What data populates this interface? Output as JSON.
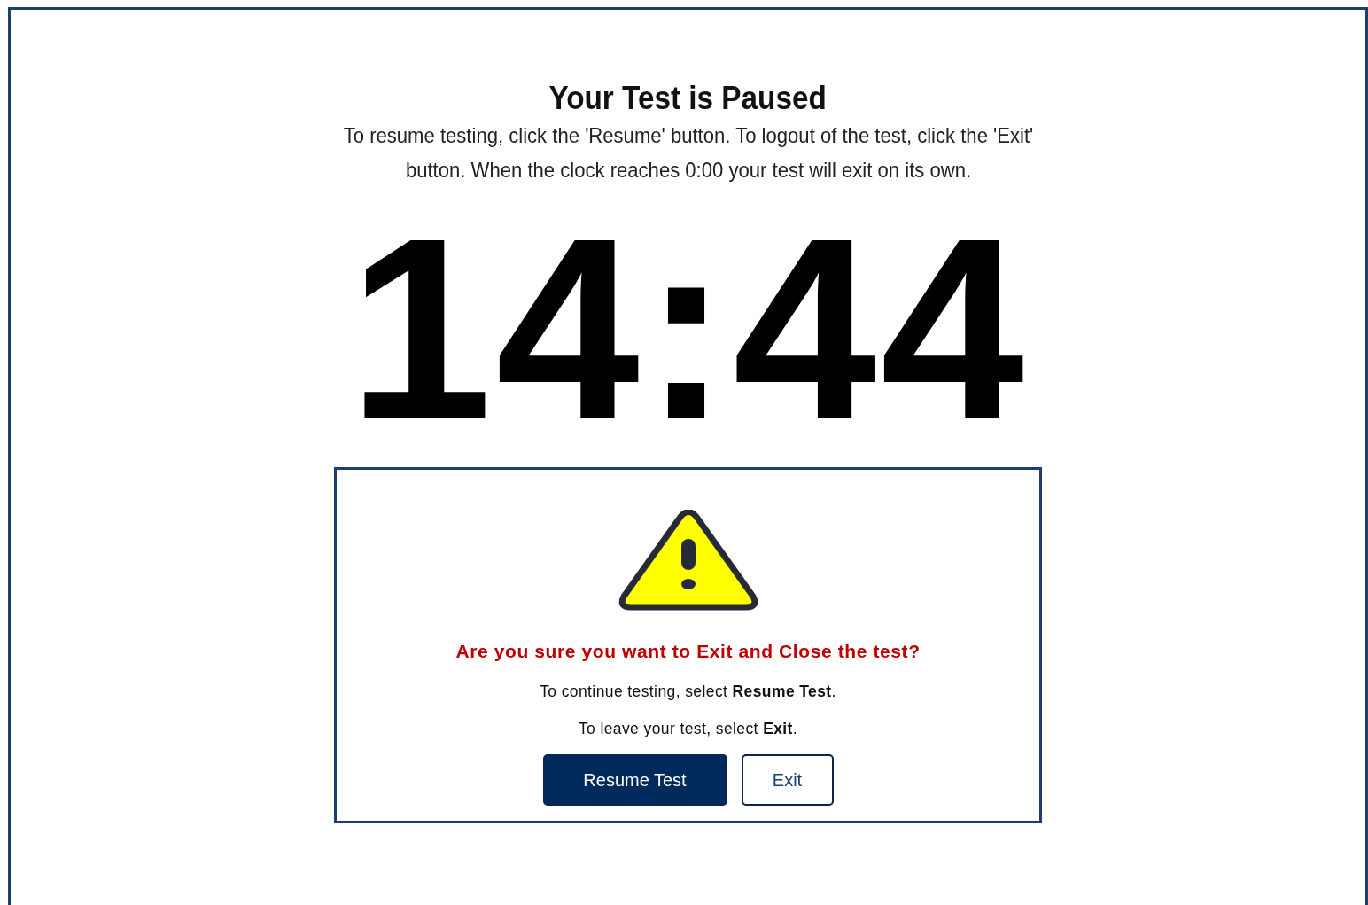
{
  "title": "Your Test is Paused",
  "instructions": "To resume testing, click the 'Resume' button. To logout of the test, click the 'Exit' button. When the clock reaches 0:00 your test will exit on its own.",
  "clock": "14:44",
  "dialog": {
    "question": "Are you sure you want to Exit and Close the test?",
    "lines": [
      "To continue testing, select **Resume Test**.",
      "To leave your test, select **Exit**."
    ],
    "buttons": [
      {
        "label": "Resume Test",
        "kind": "primary"
      },
      {
        "label": "Exit",
        "kind": "secondary"
      }
    ]
  }
}
